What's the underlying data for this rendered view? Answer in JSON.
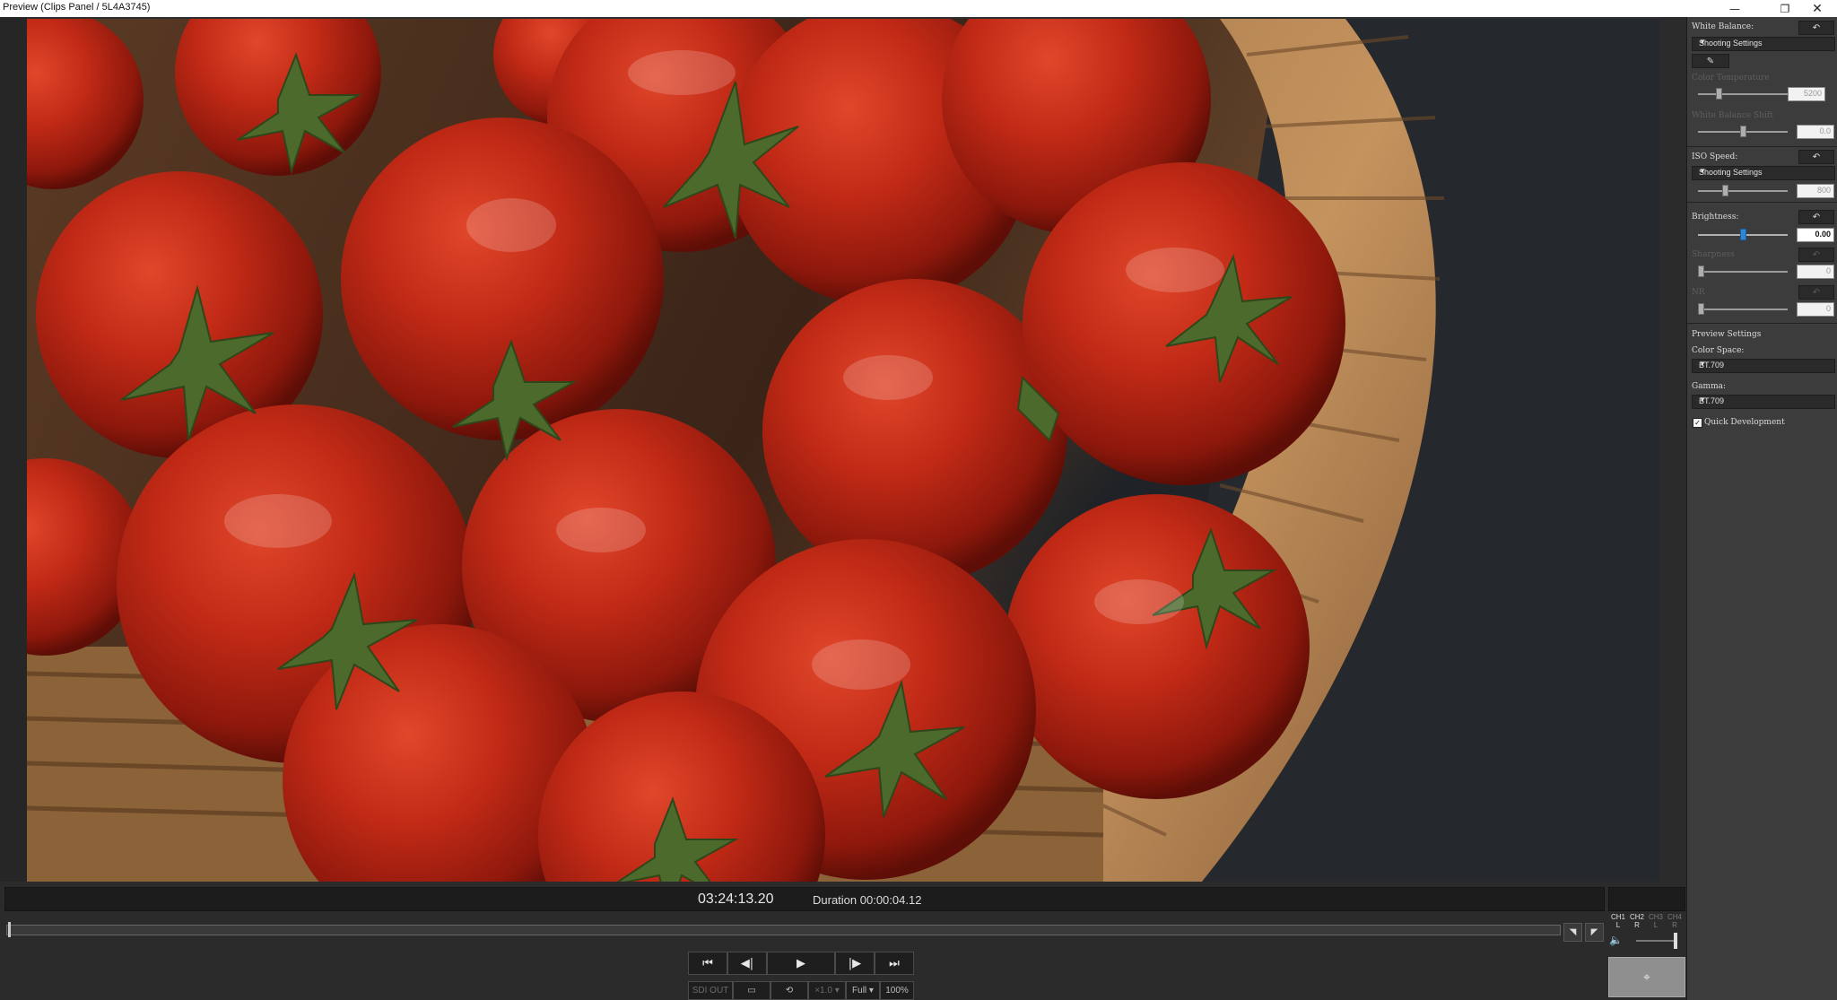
{
  "window": {
    "title": "Preview (Clips Panel / 5L4A3745)",
    "minimize": "—",
    "restore": "❐",
    "close": "✕"
  },
  "viewer": {
    "timecode": "03:24:13.20",
    "duration": "Duration 00:00:04.12",
    "playhead_fraction": 0.0
  },
  "scrub_markers": {
    "in": "◥",
    "out": "◤"
  },
  "transport": {
    "first": "⏮",
    "prev_frame": "◀|",
    "play": "▶",
    "next_frame": "|▶",
    "last": "⏭"
  },
  "bottom": {
    "sdi_out": "SDI OUT",
    "speed": "×1.0 ▾",
    "quality": "Full ▾",
    "zoom": "100%"
  },
  "audio": {
    "channels": [
      {
        "name": "CH1",
        "side": "L",
        "active": true
      },
      {
        "name": "CH2",
        "side": "R",
        "active": true
      },
      {
        "name": "CH3",
        "side": "L",
        "active": false
      },
      {
        "name": "CH4",
        "side": "R",
        "active": false
      }
    ],
    "volume_level": 0.9
  },
  "panel": {
    "white_balance": {
      "label": "White Balance:",
      "value": "Shooting Settings"
    },
    "color_temperature": {
      "label": "Color Temperature",
      "value": "5200",
      "level": 0.2
    },
    "white_balance_shift": {
      "label": "White Balance Shift",
      "value": "0.0",
      "level": 0.5
    },
    "iso_speed": {
      "label": "ISO Speed:",
      "value": "Shooting Settings",
      "box": "800",
      "level": 0.3
    },
    "brightness": {
      "label": "Brightness:",
      "value": "0.00",
      "level": 0.5
    },
    "sharpness": {
      "label": "Sharpness",
      "value": "0",
      "level": 0.0
    },
    "nr": {
      "label": "NR",
      "value": "0",
      "level": 0.0
    },
    "preview_settings": {
      "label": "Preview Settings"
    },
    "color_space": {
      "label": "Color Space:",
      "value": "BT.709"
    },
    "gamma": {
      "label": "Gamma:",
      "value": "BT.709"
    },
    "quick_development": {
      "label": "Quick Development",
      "checked": true
    }
  }
}
